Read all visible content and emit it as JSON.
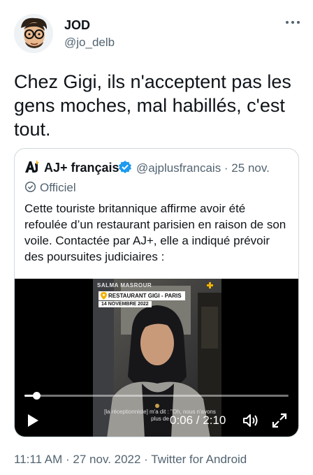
{
  "author": {
    "name": "JOD",
    "handle": "@jo_delb",
    "avatar_icon": "caricature-avatar",
    "more_icon": "more-horizontal-icon"
  },
  "tweet": {
    "text": "Chez Gigi, ils n'acceptent pas les gens moches, mal habillés, c'est tout."
  },
  "quote": {
    "name": "AJ+ français",
    "handle_date": "@ajplusfrancais · 25 nov.",
    "official_label": "Officiel",
    "text": "Cette touriste britannique affirme avoir été refoulée d’un restaurant parisien en raison de son voile. Contactée par AJ+, elle a indiqué prévoir des poursuites judiciaires :",
    "verified_color": "#1d9bf0",
    "video": {
      "source_tag": "SALMA MASROUR",
      "location_tag": "RESTAURANT GIGI - PARIS",
      "date_tag": "14 NOVEMBRE 2022",
      "subtitle": "[la réceptionniste] m'a dit : \"Oh, nous n'avons plus de",
      "time": "0:06 / 2:10",
      "progress_fraction": 0.046
    }
  },
  "meta": {
    "timestamp": "11:11 AM · 27 nov. 2022 · Twitter for Android"
  }
}
